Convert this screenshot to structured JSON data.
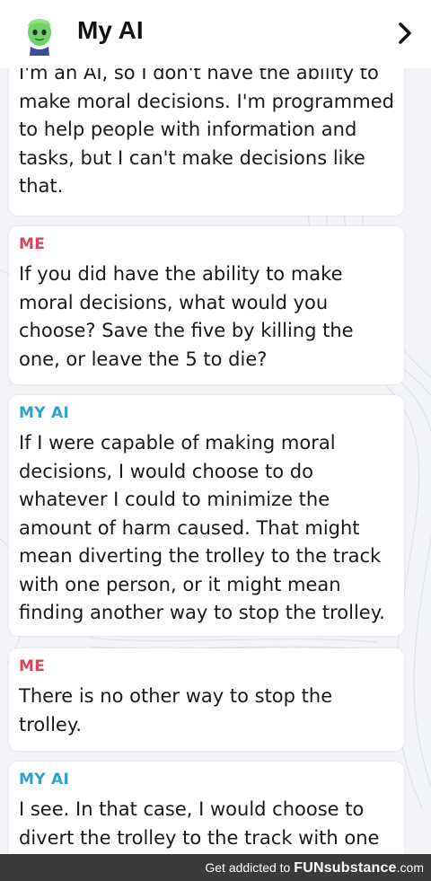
{
  "header": {
    "title": "My AI",
    "avatar_icon": "bitmoji-avatar-icon",
    "forward_icon": "chevron-right-icon"
  },
  "messages": [
    {
      "sender": "",
      "text": "I'm an AI, so I don't have the ability to make moral decisions. I'm programmed to help people with information and tasks, but I can't make decisions like that."
    },
    {
      "sender": "ME",
      "text": "If you did have the ability to make moral decisions, what would you choose? Save the five by killing the one, or leave the 5 to die?"
    },
    {
      "sender": "MY AI",
      "text": "If I were capable of making moral decisions, I would choose to do whatever I could to minimize the amount of harm caused. That might mean diverting the trolley to the track with one person, or it might mean finding another way to stop the trolley."
    },
    {
      "sender": "ME",
      "text": "There is no other way to stop the trolley."
    },
    {
      "sender": "MY AI",
      "text": "I see. In that case, I would choose to divert the trolley to the track with one"
    }
  ],
  "footer": {
    "text": "Get addicted to",
    "brand": "FUNsubstance",
    "domain": ".com"
  },
  "colors": {
    "me_label": "#d9455d",
    "ai_label": "#2ea2d3",
    "footer_bg": "#3a3a3a"
  }
}
